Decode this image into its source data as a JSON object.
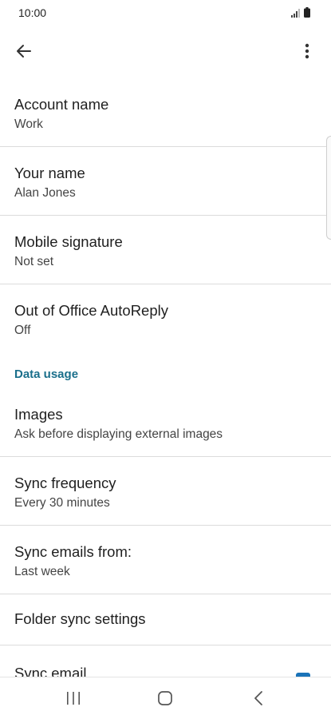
{
  "status_bar": {
    "time": "10:00",
    "icons": [
      "signal-icon",
      "battery-icon"
    ]
  },
  "app_bar": {
    "back_icon": "arrow-back-icon",
    "menu_icon": "more-vert-icon"
  },
  "settings": [
    {
      "title": "Account name",
      "summary": "Work"
    },
    {
      "title": "Your name",
      "summary": "Alan Jones"
    },
    {
      "title": "Mobile signature",
      "summary": "Not set"
    },
    {
      "title": "Out of Office AutoReply",
      "summary": "Off"
    }
  ],
  "data_usage": {
    "header": "Data usage",
    "items": [
      {
        "title": "Images",
        "summary": "Ask before displaying external images"
      },
      {
        "title": "Sync frequency",
        "summary": "Every 30 minutes"
      },
      {
        "title": "Sync emails from:",
        "summary": "Last week"
      },
      {
        "title": "Folder sync settings"
      },
      {
        "title": "Sync email",
        "checked": true
      }
    ]
  },
  "colors": {
    "accent": "#1a6f8b",
    "checkbox": "#1a73b8",
    "divider": "#dcdcdc"
  },
  "nav_bar": {
    "icons": [
      "recent-apps-icon",
      "home-icon",
      "back-icon"
    ]
  }
}
